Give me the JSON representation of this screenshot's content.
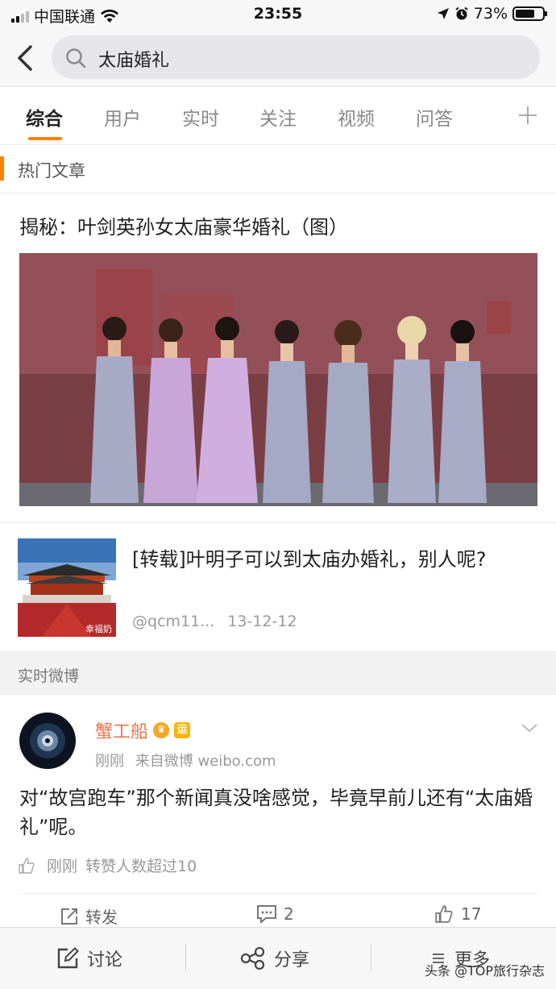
{
  "status_bar": {
    "carrier": "中国联通",
    "time": "23:55",
    "battery": "73%",
    "battery_level": 0.73
  },
  "search": {
    "query": "太庙婚礼"
  },
  "tabs": [
    {
      "label": "综合",
      "active": true
    },
    {
      "label": "用户",
      "active": false
    },
    {
      "label": "实时",
      "active": false
    },
    {
      "label": "关注",
      "active": false
    },
    {
      "label": "视频",
      "active": false
    },
    {
      "label": "问答",
      "active": false
    }
  ],
  "hot_articles": {
    "section_title": "热门文章",
    "featured": {
      "title": "揭秘：叶剑英孙女太庙豪华婚礼（图）"
    },
    "item": {
      "title": "[转载]叶明子可以到太庙办婚礼，别人呢?",
      "thumb_caption": "幸福奶",
      "author": "@qcm11...",
      "date": "13-12-12"
    }
  },
  "realtime": {
    "section_title": "实时微博",
    "post": {
      "user": "蟹工船",
      "badge_text": "运",
      "time": "刚刚",
      "source": "来自微博 weibo.com",
      "text": "对“故宫跑车”那个新闻真没啥感觉，毕竟早前儿还有“太庙婚礼”呢。",
      "likes_note_time": "刚刚",
      "likes_note": "转赞人数超过10",
      "actions": {
        "repost": "转发",
        "comments": "2",
        "likes": "17"
      }
    }
  },
  "bottom_bar": {
    "discuss": "讨论",
    "share": "分享",
    "more": "更多",
    "watermark": "头条 @TOP旅行杂志"
  },
  "colors": {
    "accent": "#ff8200",
    "username": "#eb7350"
  }
}
